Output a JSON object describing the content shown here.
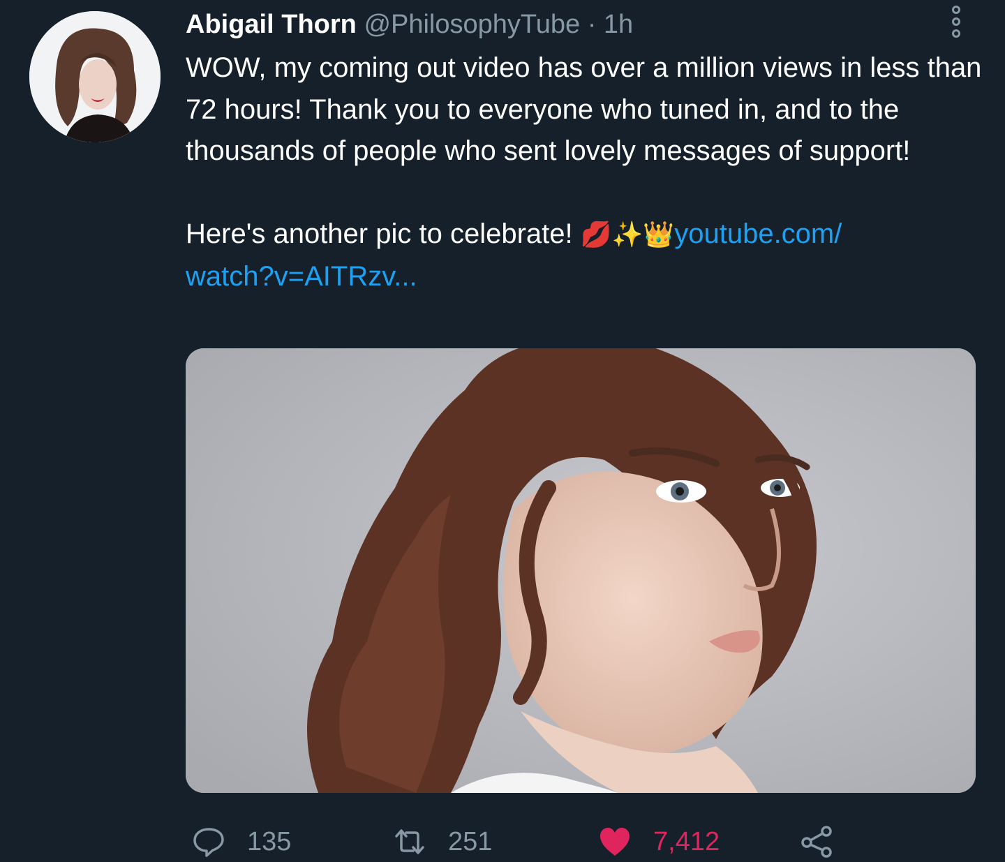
{
  "tweet": {
    "author_name": "Abigail Thorn",
    "author_handle": "@PhilosophyTube",
    "separator": "·",
    "time": "1h",
    "paragraph1": "WOW, my coming out video has over a million views in less than 72 hours! Thank you to everyone who tuned in, and to the thousands of people who sent lovely messages of support!",
    "paragraph2_text": "Here's another pic to celebrate!",
    "emoji_kiss": "💋",
    "emoji_sparkles": "✨",
    "emoji_crown": "👑",
    "link_part1": "youtube.com/",
    "link_part2": "watch?v=AITRzv..."
  },
  "actions": {
    "reply_count": "135",
    "retweet_count": "251",
    "like_count": "7,412"
  },
  "icons": {
    "more": "more-options-icon",
    "reply": "reply-icon",
    "retweet": "retweet-icon",
    "like": "heart-icon",
    "share": "share-icon"
  },
  "colors": {
    "background": "#15202b",
    "secondary_text": "#8899a6",
    "link": "#1da1f2",
    "like": "#e0245e"
  }
}
